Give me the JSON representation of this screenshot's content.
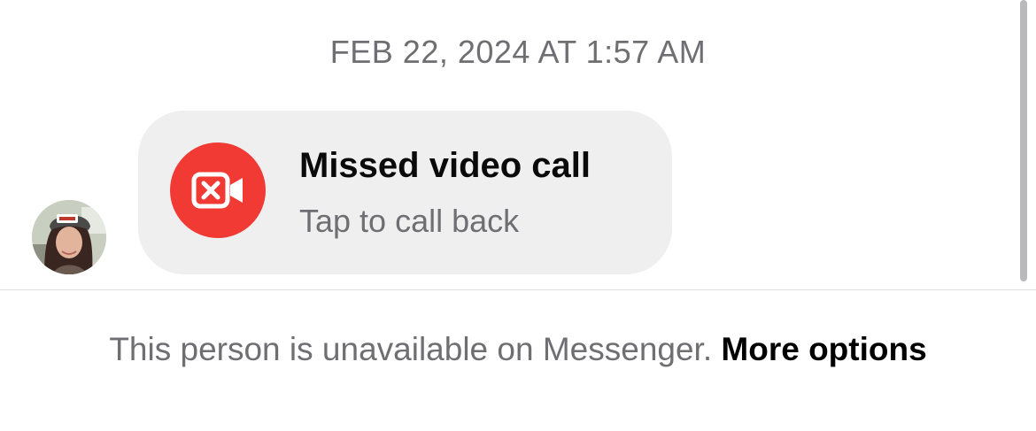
{
  "thread": {
    "timestamp": "FEB 22, 2024 AT 1:57 AM",
    "call_event": {
      "title": "Missed video call",
      "subtitle": "Tap to call back",
      "icon": "video-camera-x-icon",
      "icon_color": "#f13a34"
    }
  },
  "footer": {
    "notice": "This person is unavailable on Messenger.",
    "link_label": "More options"
  },
  "colors": {
    "bubble": "#efeff0",
    "secondary_text": "#6f6f73",
    "primary_text": "#0a0a0a"
  }
}
